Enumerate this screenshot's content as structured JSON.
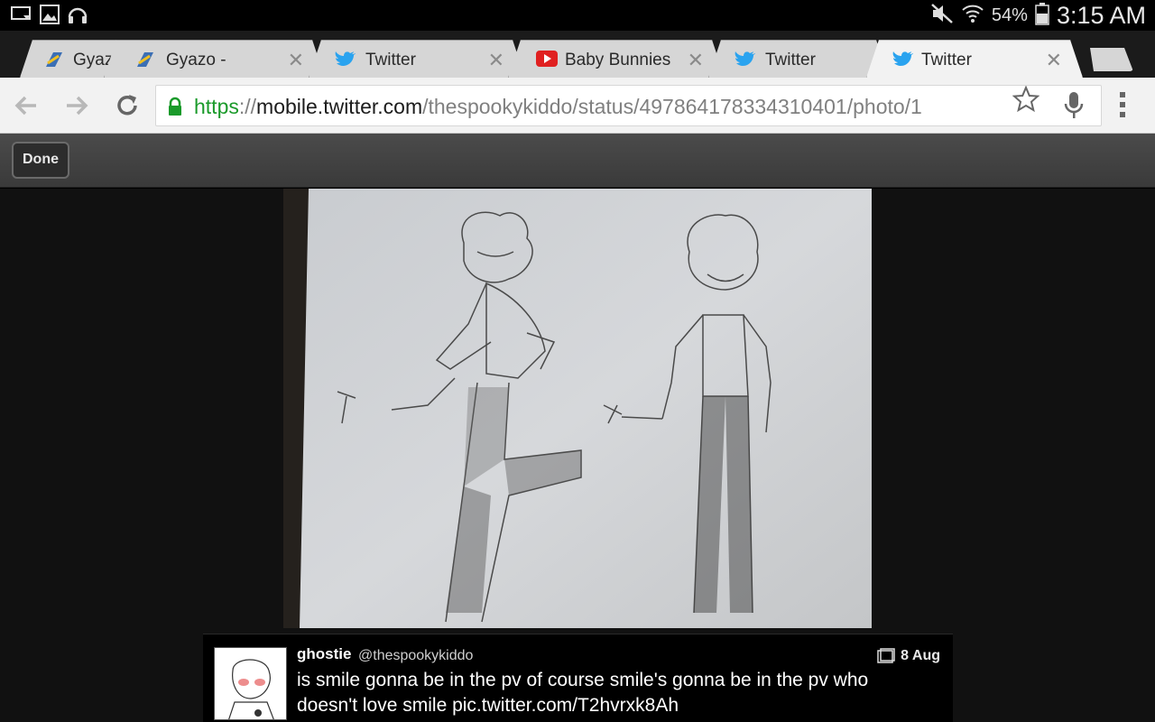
{
  "status_bar": {
    "battery": "54%",
    "time": "3:15 AM"
  },
  "tabs": [
    {
      "title": "Gyaz",
      "favicon": "gyazo-icon",
      "active": false
    },
    {
      "title": "Gyazo -",
      "favicon": "gyazo-icon",
      "active": false
    },
    {
      "title": "Twitter",
      "favicon": "twitter-bird-icon",
      "active": false
    },
    {
      "title": "Baby Bunnies",
      "favicon": "youtube-icon",
      "active": false
    },
    {
      "title": "Twitter",
      "favicon": "twitter-bird-icon",
      "active": false
    },
    {
      "title": "Twitter",
      "favicon": "twitter-bird-icon",
      "active": true
    }
  ],
  "omnibox": {
    "scheme": "https",
    "separator": "://",
    "host": "mobile.twitter.com",
    "path": "/thespookykiddo/status/497864178334310401/photo/1"
  },
  "viewer": {
    "done_label": "Done"
  },
  "tweet": {
    "name": "ghostie",
    "handle": "@thespookykiddo",
    "date": "8 Aug",
    "text": "is smile gonna be in the pv of course smile's gonna be in the pv who doesn't love smile pic.twitter.com/T2hvrxk8Ah"
  },
  "colors": {
    "secure_scheme": "#1a9a2a",
    "twitter_blue": "#2aa3ef",
    "youtube_red": "#e02020"
  }
}
